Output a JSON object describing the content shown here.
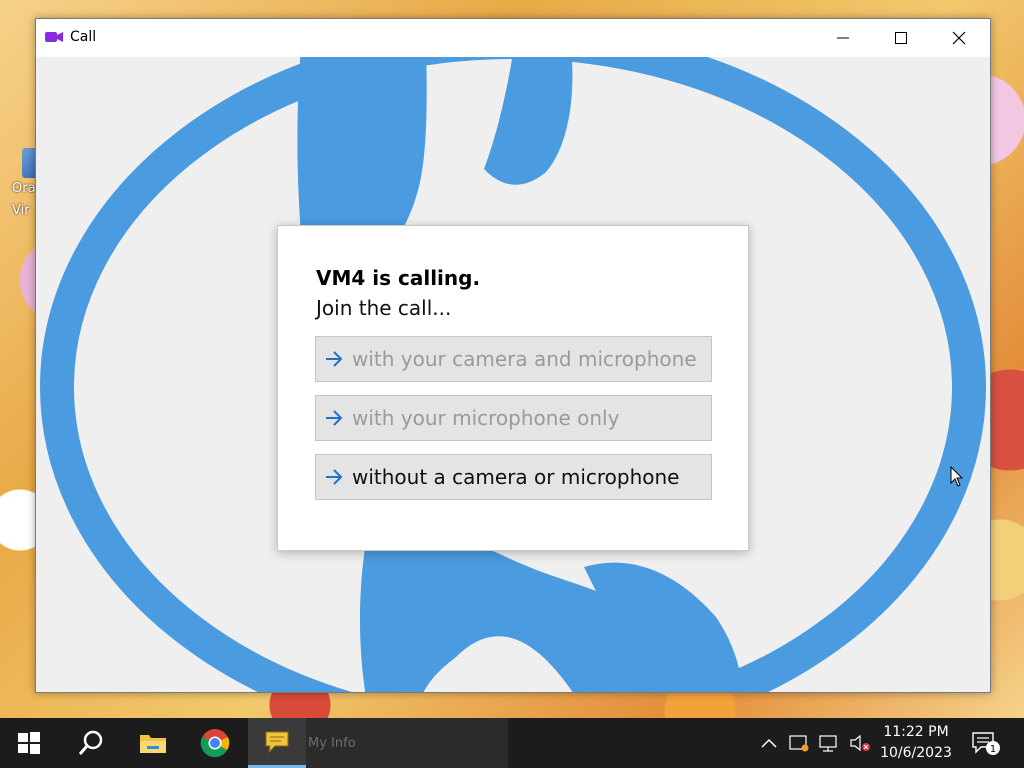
{
  "desktop": {
    "icon_label": "Ora\nVir"
  },
  "window": {
    "title": "Call",
    "app_icon": "video-camera-icon",
    "accent": "#8a2be2",
    "background_art_color": "#4a9be0"
  },
  "dialog": {
    "heading": "VM4 is calling.",
    "subheading": "Join the call...",
    "options": [
      {
        "label": "with your camera and microphone",
        "enabled": false
      },
      {
        "label": "with your microphone only",
        "enabled": false
      },
      {
        "label": "without a camera or microphone",
        "enabled": true
      }
    ],
    "arrow_color": "#1e73c8"
  },
  "taskbar": {
    "pinned": [
      "windows-start-icon",
      "search-icon",
      "file-explorer-icon",
      "chrome-icon",
      "chat-icon"
    ],
    "active_window_label": "My Info",
    "tray_icons": [
      "chevron-up-icon",
      "update-icon",
      "network-icon",
      "volume-muted-icon"
    ],
    "time": "11:22 PM",
    "date": "10/6/2023",
    "notification_count": "1"
  }
}
